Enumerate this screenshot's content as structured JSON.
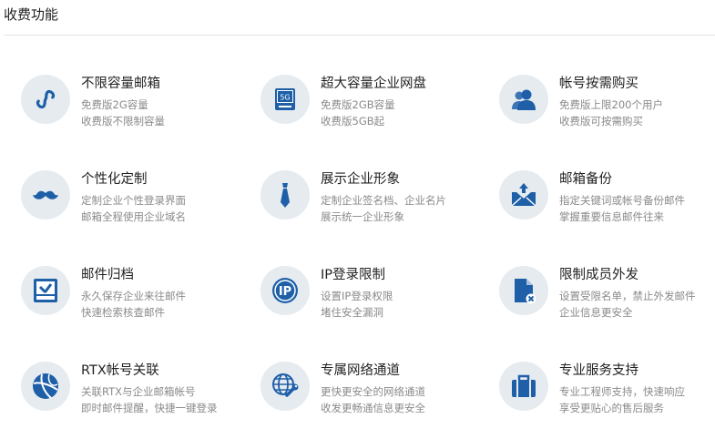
{
  "section": {
    "title": "收费功能"
  },
  "colors": {
    "icon": "#1e5fa8",
    "icon_bg": "#e6ebf0",
    "divider": "#e2e2e2"
  },
  "features": [
    {
      "title": "不限容量邮箱",
      "line1": "免费版2G容量",
      "line2": "收费版不限制容量",
      "icon": "infinity-icon"
    },
    {
      "title": "超大容量企业网盘",
      "line1": "免费版2GB容量",
      "line2": "收费版5GB起",
      "icon": "storage-5g-icon",
      "icon_text": "5G"
    },
    {
      "title": "帐号按需购买",
      "line1": "免费版上限200个用户",
      "line2": "收费版可按需购买",
      "icon": "users-icon"
    },
    {
      "title": "个性化定制",
      "line1": "定制企业个性登录界面",
      "line2": "邮箱全程使用企业域名",
      "icon": "mustache-icon"
    },
    {
      "title": "展示企业形象",
      "line1": "定制企业签名档、企业名片",
      "line2": "展示统一企业形象",
      "icon": "necktie-icon"
    },
    {
      "title": "邮箱备份",
      "line1": "指定关键词或帐号备份邮件",
      "line2": "掌握重要信息邮件往来",
      "icon": "mail-backup-icon"
    },
    {
      "title": "邮件归档",
      "line1": "永久保存企业来往邮件",
      "line2": "快速检索核查邮件",
      "icon": "archive-icon"
    },
    {
      "title": "IP登录限制",
      "line1": "设置IP登录权限",
      "line2": "堵住安全漏洞",
      "icon": "ip-icon",
      "icon_text": "IP"
    },
    {
      "title": "限制成员外发",
      "line1": "设置受限名单，禁止外发邮件",
      "line2": "企业信息更安全",
      "icon": "file-block-icon"
    },
    {
      "title": "RTX帐号关联",
      "line1": "关联RTX与企业邮箱帐号",
      "line2": "即时邮件提醒，快捷一键登录",
      "icon": "rtx-ball-icon"
    },
    {
      "title": "专属网络通道",
      "line1": "更快更安全的网络通道",
      "line2": "收发更畅通信息更安全",
      "icon": "globe-wrench-icon"
    },
    {
      "title": "专业服务支持",
      "line1": "专业工程师支持，快速响应",
      "line2": "享受更贴心的售后服务",
      "icon": "briefcase-icon"
    }
  ]
}
